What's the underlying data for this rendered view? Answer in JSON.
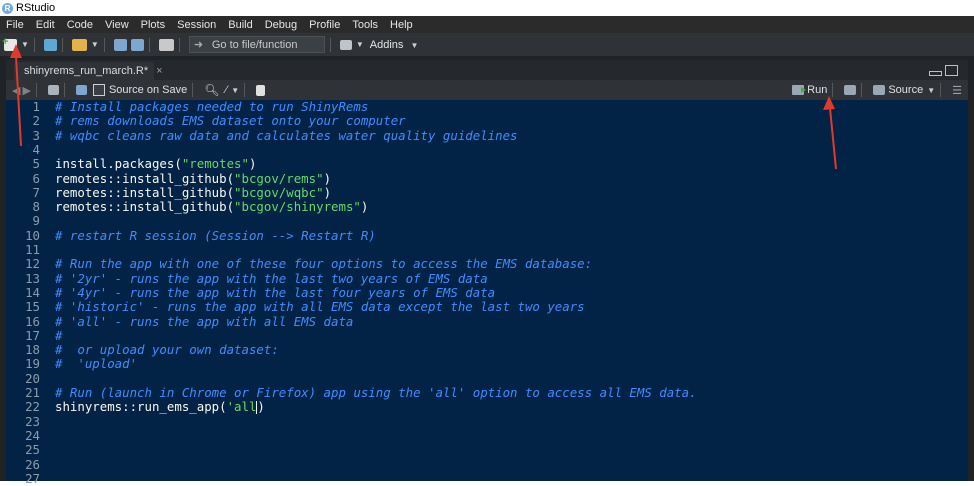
{
  "window": {
    "title": "RStudio"
  },
  "menu": [
    "File",
    "Edit",
    "Code",
    "View",
    "Plots",
    "Session",
    "Build",
    "Debug",
    "Profile",
    "Tools",
    "Help"
  ],
  "toolbar": {
    "goto_placeholder": "Go to file/function",
    "addins_label": "Addins"
  },
  "editor_tab": {
    "filename": "shinyrems_run_march.R*",
    "close_glyph": "×"
  },
  "editor_toolbar": {
    "source_on_save": "Source on Save",
    "run_label": "Run",
    "source_label": "Source"
  },
  "code_lines": [
    {
      "n": "1",
      "segments": [
        {
          "t": "# Install packages needed to run ShinyRems",
          "c": "comment"
        }
      ]
    },
    {
      "n": "2",
      "segments": [
        {
          "t": "# rems downloads EMS dataset onto your computer",
          "c": "comment"
        }
      ]
    },
    {
      "n": "3",
      "segments": [
        {
          "t": "# wqbc cleans raw data and calculates water quality guidelines",
          "c": "comment"
        }
      ]
    },
    {
      "n": "4",
      "segments": []
    },
    {
      "n": "5",
      "segments": [
        {
          "t": "install.packages(",
          "c": "code"
        },
        {
          "t": "\"remotes\"",
          "c": "string"
        },
        {
          "t": ")",
          "c": "code"
        }
      ]
    },
    {
      "n": "6",
      "segments": [
        {
          "t": "remotes::install_github(",
          "c": "code"
        },
        {
          "t": "\"bcgov/rems\"",
          "c": "string"
        },
        {
          "t": ")",
          "c": "code"
        }
      ]
    },
    {
      "n": "7",
      "segments": [
        {
          "t": "remotes::install_github(",
          "c": "code"
        },
        {
          "t": "\"bcgov/wqbc\"",
          "c": "string"
        },
        {
          "t": ")",
          "c": "code"
        }
      ]
    },
    {
      "n": "8",
      "segments": [
        {
          "t": "remotes::install_github(",
          "c": "code"
        },
        {
          "t": "\"bcgov/shinyrems\"",
          "c": "string"
        },
        {
          "t": ")",
          "c": "code"
        }
      ]
    },
    {
      "n": "9",
      "segments": []
    },
    {
      "n": "10",
      "segments": [
        {
          "t": "# restart R session (Session --> Restart R)",
          "c": "comment"
        }
      ]
    },
    {
      "n": "11",
      "segments": []
    },
    {
      "n": "12",
      "segments": [
        {
          "t": "# Run the app with one of these four options to access the EMS database:",
          "c": "comment"
        }
      ]
    },
    {
      "n": "13",
      "segments": [
        {
          "t": "# '2yr' - runs the app with the last two years of EMS data",
          "c": "comment"
        }
      ]
    },
    {
      "n": "14",
      "segments": [
        {
          "t": "# '4yr' - runs the app with the last four years of EMS data",
          "c": "comment"
        }
      ]
    },
    {
      "n": "15",
      "segments": [
        {
          "t": "# 'historic' - runs the app with all EMS data except the last two years",
          "c": "comment"
        }
      ]
    },
    {
      "n": "16",
      "segments": [
        {
          "t": "# 'all' - runs the app with all EMS data",
          "c": "comment"
        }
      ]
    },
    {
      "n": "17",
      "segments": [
        {
          "t": "#",
          "c": "comment"
        }
      ]
    },
    {
      "n": "18",
      "segments": [
        {
          "t": "#  or upload your own dataset:",
          "c": "comment"
        }
      ]
    },
    {
      "n": "19",
      "segments": [
        {
          "t": "#  'upload'",
          "c": "comment"
        }
      ]
    },
    {
      "n": "20",
      "segments": []
    },
    {
      "n": "21",
      "segments": [
        {
          "t": "# Run (launch in Chrome or Firefox) app using the 'all' option to access all EMS data.",
          "c": "comment"
        }
      ]
    },
    {
      "n": "22",
      "segments": [
        {
          "t": "shinyrems::run_ems_app(",
          "c": "code"
        },
        {
          "t": "'all",
          "c": "string"
        },
        {
          "t": "|cursor|",
          "c": "cursor"
        },
        {
          "t": ")",
          "c": "code"
        }
      ]
    },
    {
      "n": "23",
      "segments": []
    },
    {
      "n": "24",
      "segments": []
    },
    {
      "n": "25",
      "segments": []
    },
    {
      "n": "26",
      "segments": []
    },
    {
      "n": "27",
      "segments": []
    }
  ],
  "colors": {
    "editor_bg": "#022346",
    "comment": "#3f8cff",
    "string": "#66d966",
    "annotation_arrow": "#e03a2a"
  }
}
